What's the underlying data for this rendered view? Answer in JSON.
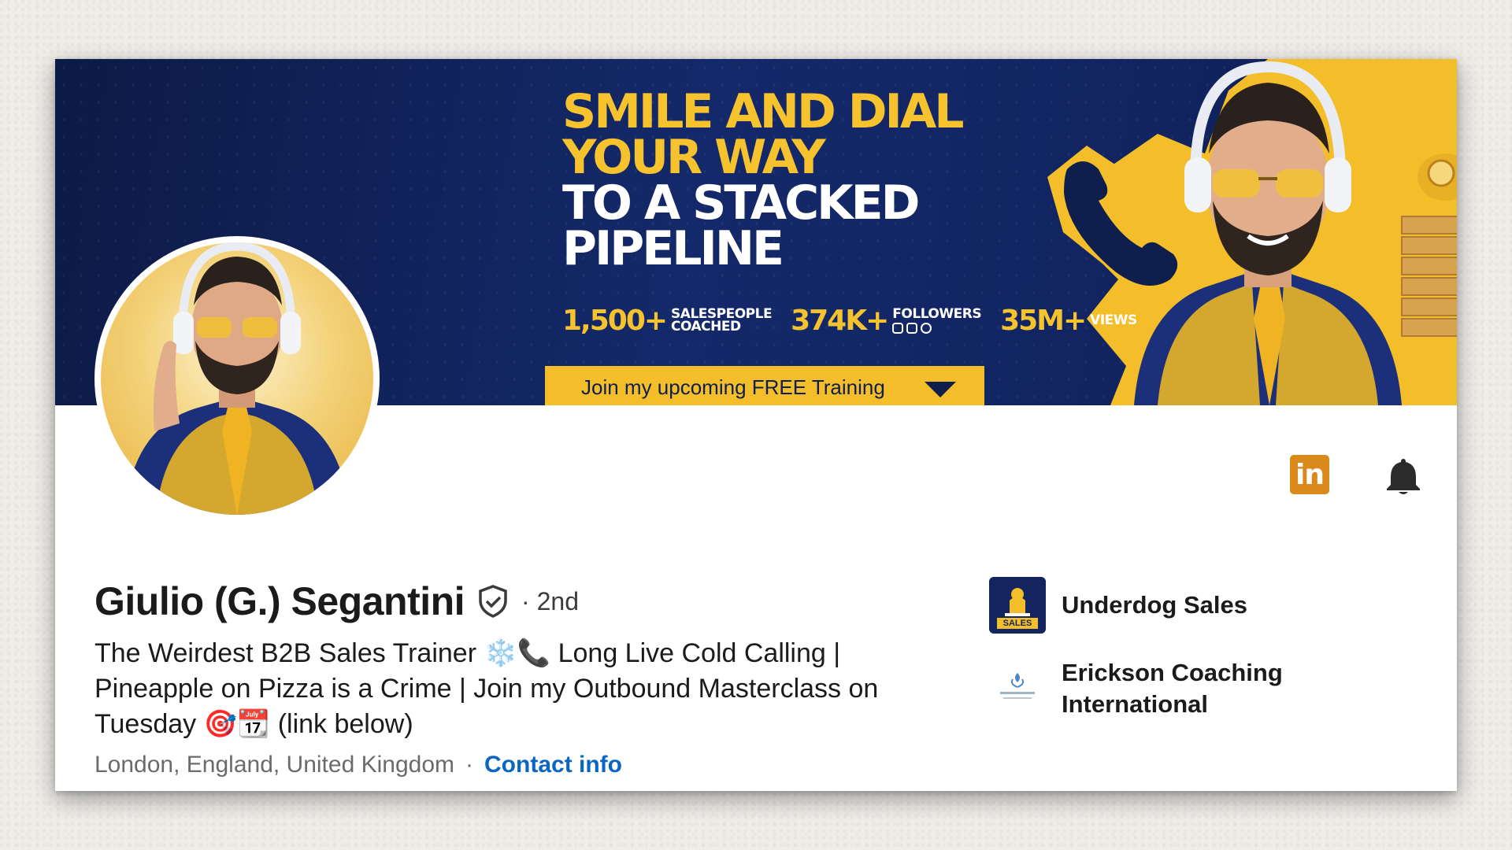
{
  "banner": {
    "headline_line1": "SMILE AND DIAL",
    "headline_line2": "YOUR WAY",
    "headline_line3": "TO A STACKED",
    "headline_line4": "PIPELINE",
    "stats": [
      {
        "number": "1,500+",
        "label_line1": "SALESPEOPLE",
        "label_line2": "COACHED"
      },
      {
        "number": "374K+",
        "label_line1": "FOLLOWERS",
        "label_line2": ""
      },
      {
        "number": "35M+",
        "label_line1": "VIEWS",
        "label_line2": ""
      }
    ],
    "training_cta": "Join my upcoming FREE Training",
    "accent_color": "#f6c22d",
    "background_color": "#122563"
  },
  "profile": {
    "name": "Giulio (G.) Segantini",
    "connection_degree": "· 2nd",
    "headline": "The Weirdest B2B Sales Trainer ❄️📞 Long Live Cold Calling | Pineapple on Pizza is a Crime | Join my Outbound Masterclass on Tuesday 🎯📆 (link below)",
    "location": "London, England, United Kingdom",
    "separator": "·",
    "contact_link": "Contact info"
  },
  "actions": {
    "linkedin_label": "in",
    "linkedin_color": "#d98a1a"
  },
  "companies": [
    {
      "name": "Underdog Sales",
      "logo_text": "SALES",
      "icon": "underdog-sales-logo"
    },
    {
      "name_line1": "Erickson Coaching",
      "name_line2": "International",
      "icon": "erickson-coaching-logo"
    }
  ],
  "icons": {
    "verify": "shield-check-icon",
    "notify": "bell-icon",
    "linkedin": "linkedin-icon"
  }
}
